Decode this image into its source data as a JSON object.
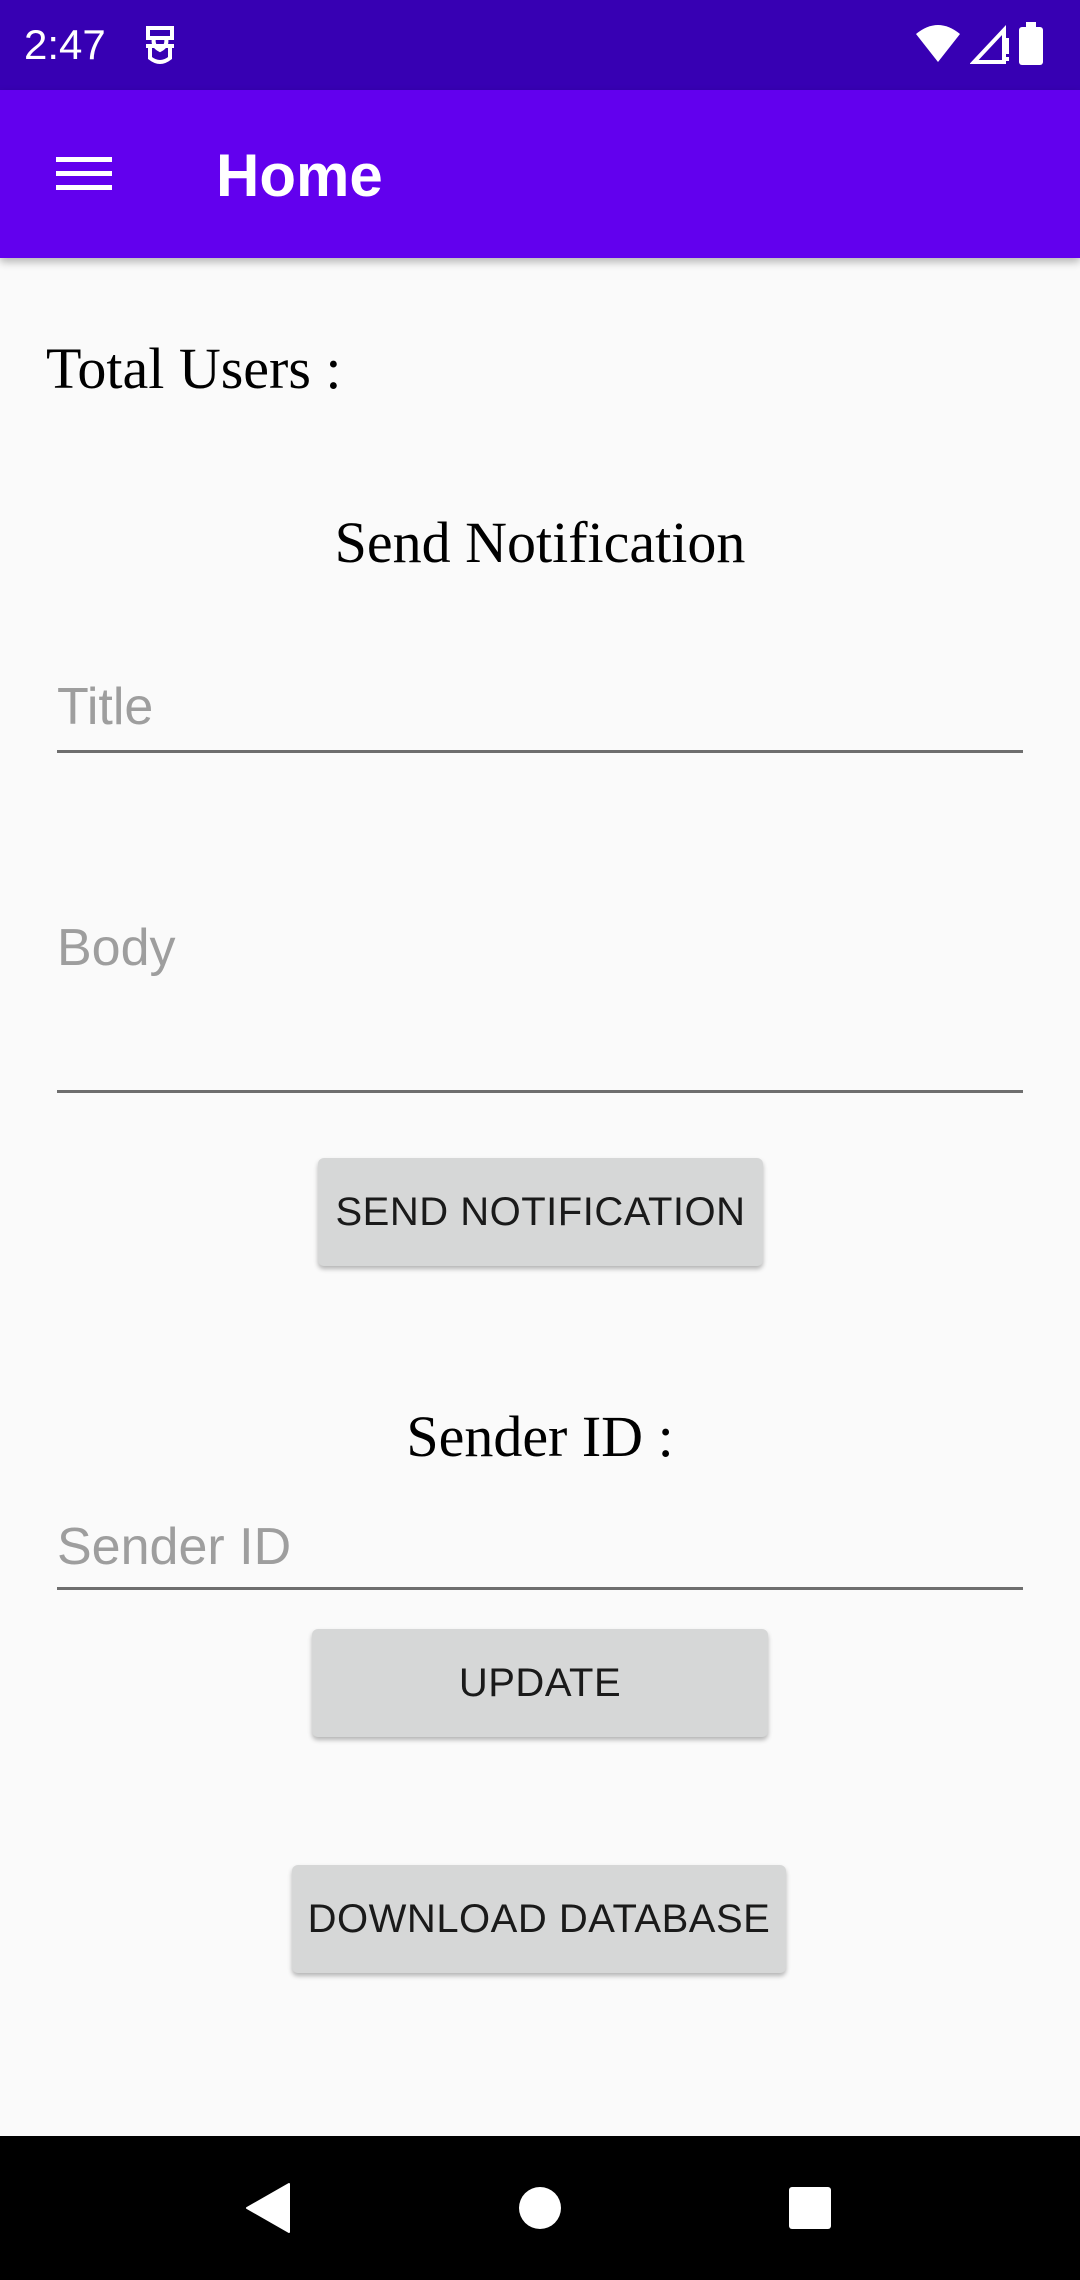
{
  "status_bar": {
    "time": "2:47",
    "left_icon": "sim-toolkit-icon",
    "right_icons": [
      "wifi-icon",
      "signal-icon",
      "battery-icon"
    ]
  },
  "app_bar": {
    "title": "Home",
    "menu_icon": "hamburger-menu-icon",
    "color": "#6200ee",
    "status_color": "#3700b3"
  },
  "main": {
    "total_users_label": "Total Users :",
    "send_notification_heading": "Send Notification",
    "title_placeholder": "Title",
    "body_placeholder": "Body",
    "send_button_label": "SEND NOTIFICATION",
    "sender_id_heading": "Sender ID :",
    "sender_id_placeholder": "Sender ID",
    "update_button_label": "UPDATE",
    "download_button_label": "DOWNLOAD DATABASE"
  },
  "nav_bar": {
    "icons": [
      "back-icon",
      "home-icon",
      "recents-icon"
    ]
  }
}
